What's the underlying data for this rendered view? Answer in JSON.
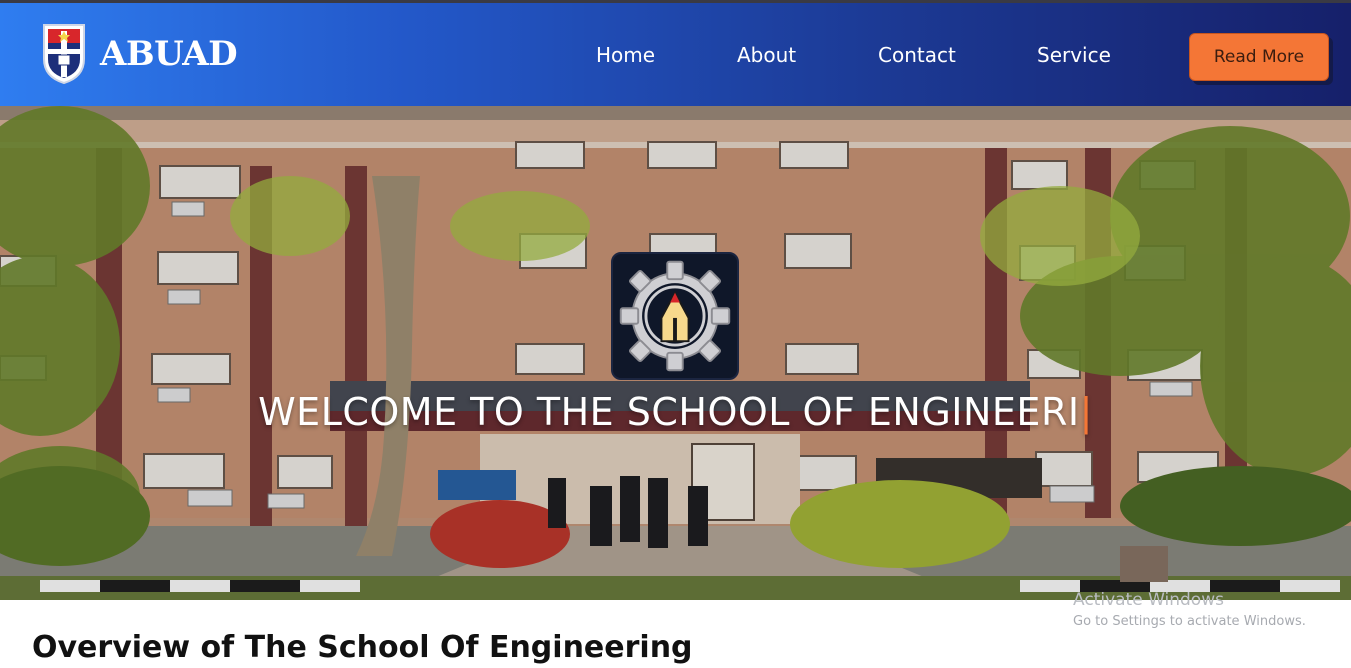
{
  "brand": {
    "name": "ABUAD",
    "logo_icon": "university-crest-icon"
  },
  "nav": {
    "links": [
      "Home",
      "About",
      "Contact",
      "Service"
    ],
    "cta_label": "Read More"
  },
  "hero": {
    "title": "WELCOME TO THE SCHOOL OF ENGINEERI",
    "icon": "engineering-gear-pencil-icon",
    "cursor": "|"
  },
  "overview": {
    "heading": "Overview of The School Of Engineering"
  },
  "watermark": {
    "line1": "Activate Windows",
    "line2": "Go to Settings to activate Windows."
  },
  "colors": {
    "nav_gradient_start": "#2f7df0",
    "nav_gradient_end": "#16206a",
    "accent": "#f47636"
  }
}
